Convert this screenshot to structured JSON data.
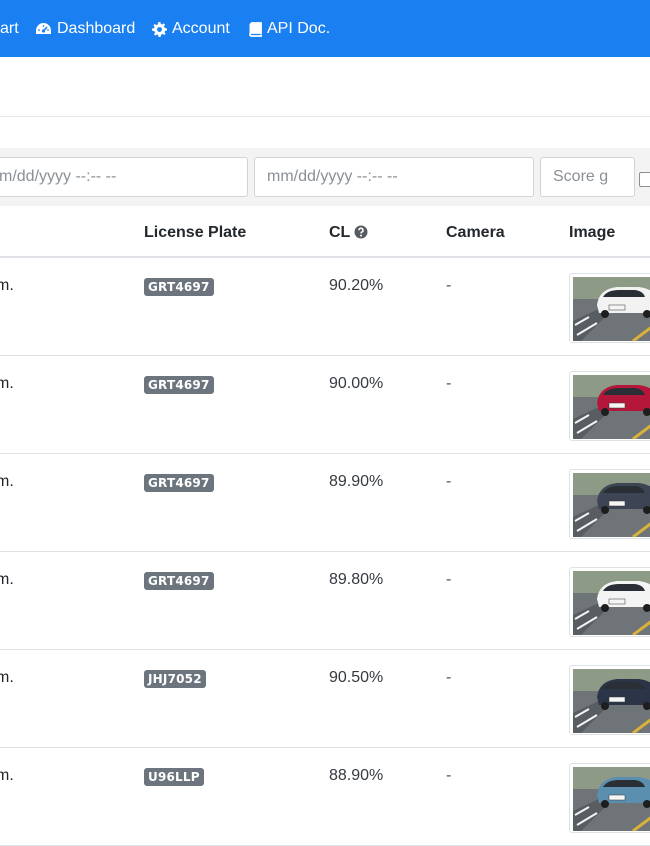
{
  "navbar": {
    "items": [
      {
        "label": "art",
        "icon": "cart-icon"
      },
      {
        "label": "Dashboard",
        "icon": "dashboard-icon"
      },
      {
        "label": "Account",
        "icon": "gear-icon"
      },
      {
        "label": "API Doc.",
        "icon": "book-icon"
      }
    ]
  },
  "filters": {
    "start_placeholder": "m/dd/yyyy --:-- --",
    "end_placeholder": "mm/dd/yyyy --:-- --",
    "score_placeholder": "Score g"
  },
  "table": {
    "headers": {
      "plate": "License Plate",
      "cl": "CL",
      "camera": "Camera",
      "image": "Image"
    },
    "rows": [
      {
        "date": "m.",
        "plate": "GRT4697",
        "cl": "90.20%",
        "camera": "-",
        "car_color": "#f2f2f2"
      },
      {
        "date": "m.",
        "plate": "GRT4697",
        "cl": "90.00%",
        "camera": "-",
        "car_color": "#b5173a"
      },
      {
        "date": "m.",
        "plate": "GRT4697",
        "cl": "89.90%",
        "camera": "-",
        "car_color": "#3d4454"
      },
      {
        "date": "m.",
        "plate": "GRT4697",
        "cl": "89.80%",
        "camera": "-",
        "car_color": "#f4f4f4"
      },
      {
        "date": "m.",
        "plate": "JHJ7052",
        "cl": "90.50%",
        "camera": "-",
        "car_color": "#2c3448"
      },
      {
        "date": "m.",
        "plate": "U96LLP",
        "cl": "88.90%",
        "camera": "-",
        "car_color": "#5b8fb0"
      }
    ]
  },
  "colors": {
    "navbar": "#1a7ff0",
    "badge": "#6c757d"
  }
}
